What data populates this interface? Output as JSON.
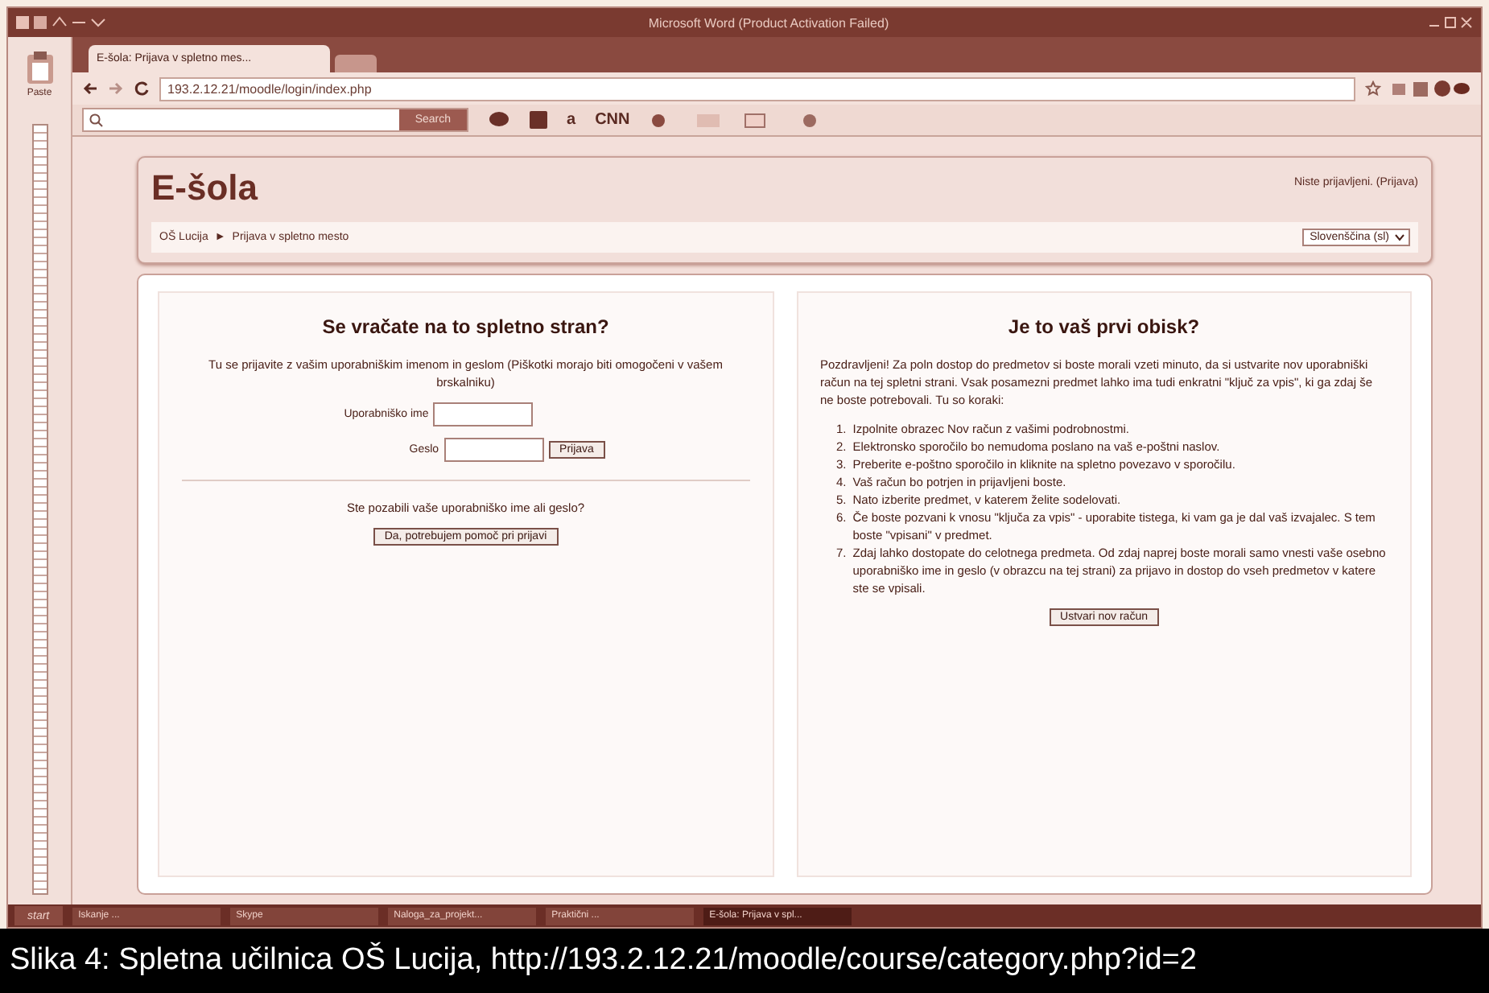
{
  "word": {
    "title": "Microsoft Word (Product Activation Failed)",
    "paste": "Paste"
  },
  "browser": {
    "tabs": [
      {
        "label": "E-šola: Prijava v spletno mes...",
        "selected": true
      }
    ],
    "address": "193.2.12.21/moodle/login/index.php",
    "toolbar": {
      "search_button": "Search",
      "items": [
        "a",
        "CNN"
      ]
    }
  },
  "page": {
    "site_name": "E-šola",
    "login_info": "Niste prijavljeni. (Prijava)",
    "breadcrumb": [
      "OŠ Lucija",
      "►",
      "Prijava v spletno mesto"
    ],
    "language": "Slovenščina (sl)",
    "returning": {
      "title": "Se vračate na to spletno stran?",
      "intro": "Tu se prijavite z vašim uporabniškim imenom in geslom (Piškotki morajo biti omogočeni v vašem brskalniku)",
      "username_label": "Uporabniško ime",
      "password_label": "Geslo",
      "login_button": "Prijava",
      "forgot": "Ste pozabili vaše uporabniško ime ali geslo?",
      "help_button": "Da, potrebujem pomoč pri prijavi"
    },
    "new_user": {
      "title": "Je to vaš prvi obisk?",
      "intro": "Pozdravljeni! Za poln dostop do predmetov si boste morali vzeti minuto, da si ustvarite nov uporabniški račun na tej spletni strani. Vsak posamezni predmet lahko ima tudi enkratni \"ključ za vpis\", ki ga zdaj še ne boste potrebovali. Tu so koraki:",
      "steps": [
        {
          "number": "1.",
          "text": "Izpolnite obrazec Nov račun z vašimi podrobnostmi."
        },
        {
          "number": "2.",
          "text": "Elektronsko sporočilo bo nemudoma poslano na vaš e-poštni naslov."
        },
        {
          "number": "3.",
          "text": "Preberite e-poštno sporočilo in kliknite na spletno povezavo v sporočilu."
        },
        {
          "number": "4.",
          "text": "Vaš račun bo potrjen in prijavljeni boste."
        },
        {
          "number": "5.",
          "text": "Nato izberite predmet, v katerem želite sodelovati."
        },
        {
          "number": "6.",
          "text": "Če boste pozvani k vnosu \"ključa za vpis\" - uporabite tistega, ki vam ga je dal vaš izvajalec. S tem boste \"vpisani\" v predmet."
        },
        {
          "number": "7.",
          "text": "Zdaj lahko dostopate do celotnega predmeta. Od zdaj naprej boste morali samo vnesti vaše osebno uporabniško ime in geslo (v obrazcu na tej strani) za prijavo in dostop do vseh predmetov v katere ste se vpisali."
        }
      ],
      "create_button": "Ustvari nov račun"
    }
  },
  "taskbar": {
    "start": "start",
    "items": [
      {
        "label": "Iskanje ...",
        "selected": false
      },
      {
        "label": "Skype",
        "selected": false
      },
      {
        "label": "Naloga_za_projekt...",
        "selected": false
      },
      {
        "label": "Praktični ...",
        "selected": false
      },
      {
        "label": "E-šola: Prijava v spl...",
        "selected": true
      }
    ]
  },
  "caption": "Slika 4: Spletna učilnica OŠ Lucija, http://193.2.12.21/moodle/course/category.php?id=2"
}
